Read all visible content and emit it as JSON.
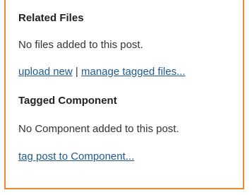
{
  "related_files": {
    "heading": "Related Files",
    "empty_text": "No files added to this post.",
    "upload_link": "upload new",
    "separator": "|",
    "manage_link": "manage tagged files..."
  },
  "tagged_component": {
    "heading": "Tagged Component",
    "empty_text": "No Component added to this post.",
    "tag_link": "tag post to Component..."
  },
  "colors": {
    "border": "#e8892f",
    "link": "#1f5a8c",
    "text": "#333333"
  }
}
